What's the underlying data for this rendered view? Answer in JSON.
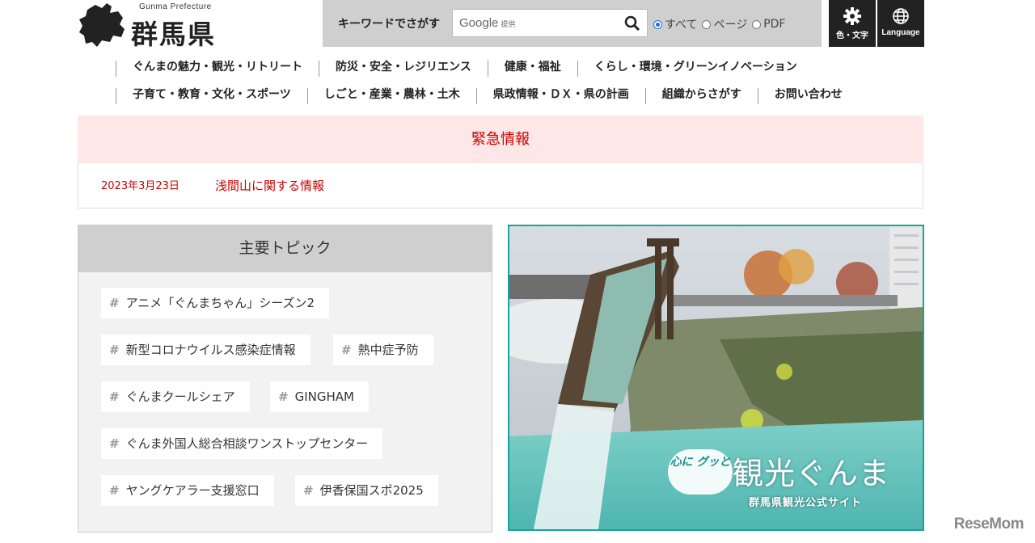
{
  "header": {
    "logo_sub": "Gunma Prefecture",
    "logo_name": "群馬県",
    "search_label": "キーワードでさがす",
    "search_brand": "Google",
    "search_brand_suffix": "提供",
    "search_options": [
      "すべて",
      "ページ",
      "PDF"
    ],
    "search_selected": "すべて",
    "color_text_label": "色・文字",
    "language_label": "Language"
  },
  "nav": {
    "row1": [
      "ぐんまの魅力・観光・リトリート",
      "防災・安全・レジリエンス",
      "健康・福祉",
      "くらし・環境・グリーンイノベーション"
    ],
    "row2": [
      "子育て・教育・文化・スポーツ",
      "しごと・産業・農林・土木",
      "県政情報・ＤＸ・県の計画",
      "組織からさがす",
      "お問い合わせ"
    ]
  },
  "emergency": {
    "title": "緊急情報",
    "date": "2023年3月23日",
    "link": "浅間山に関する情報"
  },
  "topics": {
    "title": "主要トピック",
    "hash": "#",
    "tags": [
      "アニメ「ぐんまちゃん」シーズン2",
      "新型コロナウイルス感染症情報",
      "熱中症予防",
      "ぐんまクールシェア",
      "GINGHAM",
      "ぐんま外国人総合相談ワンストップセンター",
      "ヤングケアラー支援窓口",
      "伊香保国スポ2025"
    ]
  },
  "banner": {
    "catch": "心に グッと",
    "title": "観光ぐんま",
    "subtitle": "群馬県観光公式サイト"
  },
  "watermark": "ReseMom",
  "colors": {
    "emergency_red": "#cc0000",
    "emergency_bg": "#fde7e7",
    "banner_border": "#1aa39a",
    "radio_accent": "#1a6fe0"
  }
}
